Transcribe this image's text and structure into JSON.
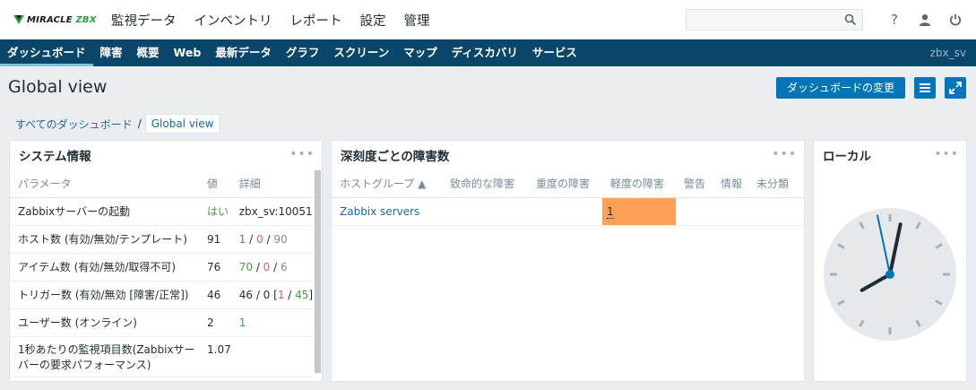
{
  "brand": {
    "logo_prefix": "MIRACLE",
    "logo_suffix": "ZBX"
  },
  "top_menu": [
    "監視データ",
    "インベントリ",
    "レポート",
    "設定",
    "管理"
  ],
  "top_icons": {
    "help": "?",
    "user": "user-icon",
    "logout": "power-icon"
  },
  "sub_nav": {
    "items": [
      "ダッシュボード",
      "障害",
      "概要",
      "Web",
      "最新データ",
      "グラフ",
      "スクリーン",
      "マップ",
      "ディスカバリ",
      "サービス"
    ],
    "server": "zbx_sv"
  },
  "header": {
    "title": "Global view",
    "edit_button": "ダッシュボードの変更",
    "breadcrumb_all": "すべてのダッシュボード",
    "breadcrumb_sep": "/",
    "breadcrumb_current": "Global view"
  },
  "system_info": {
    "title": "システム情報",
    "menu": "•••",
    "columns": [
      "パラメータ",
      "値",
      "詳細"
    ],
    "rows": [
      {
        "param": "Zabbixサーバーの起動",
        "value": "はい",
        "detail": "zbx_sv:10051"
      },
      {
        "param": "ホスト数 (有効/無効/テンプレート)",
        "value": "91",
        "d1": "1",
        "d2": "0",
        "d3": "90"
      },
      {
        "param": "アイテム数 (有効/無効/取得不可)",
        "value": "76",
        "d1": "70",
        "d2": "0",
        "d3": "6"
      },
      {
        "param": "トリガー数 (有効/無効 [障害/正常])",
        "value": "46",
        "d1": "46",
        "d2": "0",
        "d3": "1",
        "d4": "45"
      },
      {
        "param": "ユーザー数 (オンライン)",
        "value": "2",
        "d1": "1"
      },
      {
        "param_line1": "1秒あたりの監視項目数(Zabbixサー",
        "param_line2": "バーの要求パフォーマンス)",
        "value": "1.07"
      }
    ]
  },
  "problems": {
    "title": "深刻度ごとの障害数",
    "menu": "•••",
    "columns": [
      "ホストグループ ▲",
      "致命的な障害",
      "重度の障害",
      "軽度の障害",
      "警告",
      "情報",
      "未分類"
    ],
    "rows": [
      {
        "group": "Zabbix servers",
        "minor": "1"
      }
    ],
    "colors": {
      "minor": "#ffa059"
    }
  },
  "clock": {
    "title": "ローカル",
    "menu": "•••",
    "time": {
      "hour": 8,
      "minute": 1,
      "second": 58
    }
  },
  "colors": {
    "accent": "#0275b8",
    "nav": "#0a466a",
    "ok": "#429e47",
    "problem": "#e45959"
  }
}
